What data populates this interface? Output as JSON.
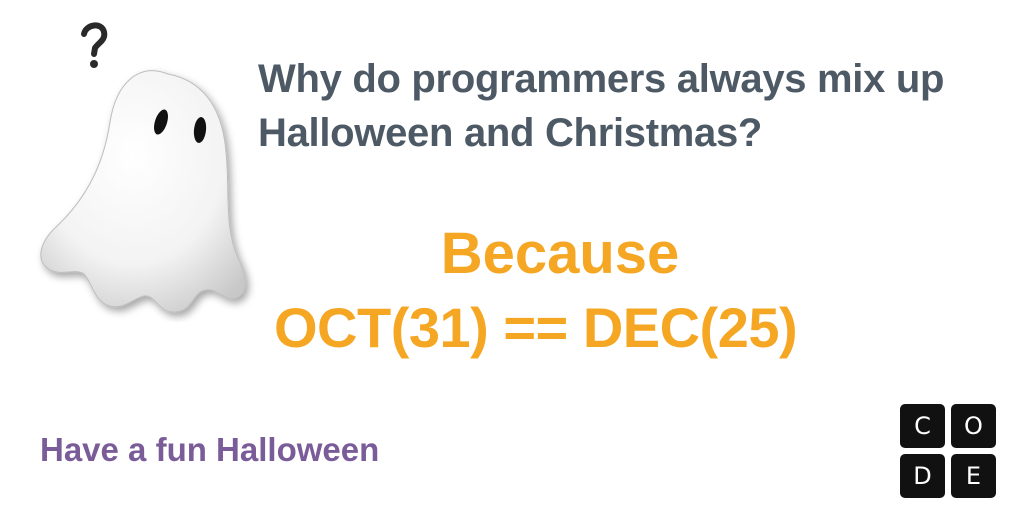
{
  "joke": {
    "question_line1": "Why do programmers always mix up",
    "question_line2": "Halloween and Christmas?",
    "answer_line1": "Because",
    "answer_line2": "OCT(31) == DEC(25)"
  },
  "footer": {
    "greeting": "Have a fun Halloween"
  },
  "logo": {
    "letters": [
      "C",
      "O",
      "D",
      "E"
    ]
  },
  "icons": {
    "ghost": "ghost-icon",
    "question_mark": "question-mark-icon"
  },
  "colors": {
    "question_text": "#4d5a66",
    "answer_text": "#f5a623",
    "footer_text": "#7a5c99",
    "logo_tile": "#111111"
  }
}
